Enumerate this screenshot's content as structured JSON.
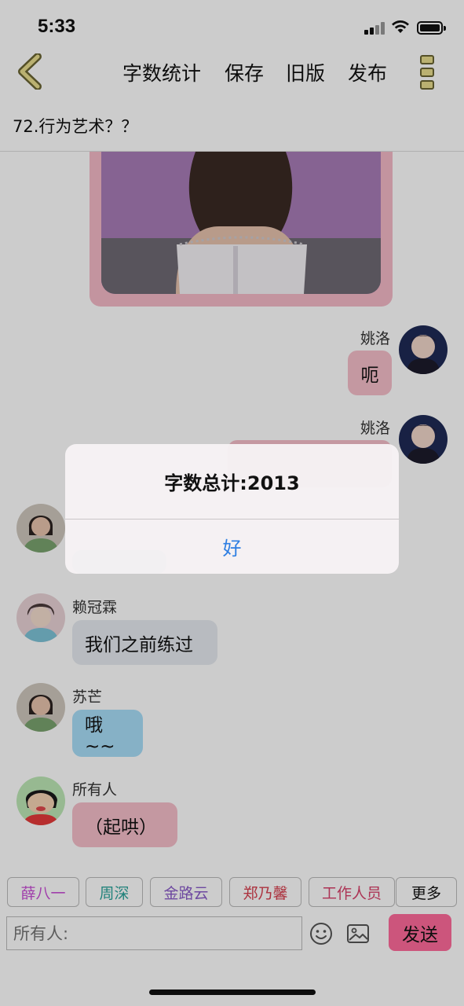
{
  "status_bar": {
    "time": "5:33"
  },
  "nav": {
    "items": [
      "字数统计",
      "保存",
      "旧版",
      "发布"
    ]
  },
  "chat": {
    "title": "72.行为艺术？？"
  },
  "messages": [
    {
      "sender": "姚洛",
      "text": "呃",
      "side": "right"
    },
    {
      "sender": "姚洛",
      "text": "",
      "side": "right"
    },
    {
      "sender": "赖冠霖",
      "text": "我们之前练过",
      "side": "left"
    },
    {
      "sender": "苏芒",
      "text": "哦~~",
      "side": "left"
    },
    {
      "sender": "所有人",
      "text": "（起哄）",
      "side": "left"
    }
  ],
  "mentions": [
    {
      "label": "薛八一",
      "color": "#c94fd6"
    },
    {
      "label": "周深",
      "color": "#2aa39a"
    },
    {
      "label": "金路云",
      "color": "#8a5cc9"
    },
    {
      "label": "郑乃馨",
      "color": "#d8404f"
    },
    {
      "label": "工作人员",
      "color": "#d8406a"
    },
    {
      "label": "更多",
      "color": "#111111"
    }
  ],
  "input": {
    "placeholder": "所有人:"
  },
  "send_label": "发送",
  "alert": {
    "title": "字数总计:2013",
    "ok_label": "好"
  }
}
